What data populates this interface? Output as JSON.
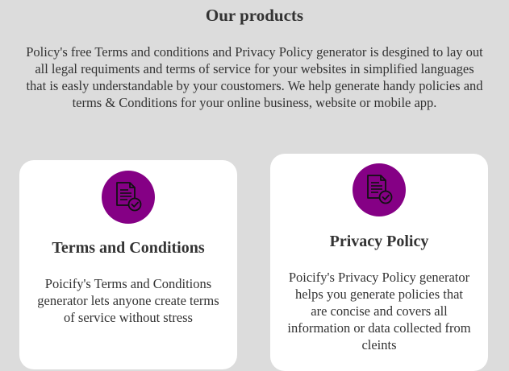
{
  "section": {
    "title": "Our products",
    "intro": "Policy's free Terms and conditions and Privacy Policy generator is desgined to lay out all legal requiments and terms of service for your websites in simplified languages that is easly understandable by your coustomers. We help generate handy policies and terms & Conditions for your online business, website or mobile app."
  },
  "cards": [
    {
      "title": "Terms and Conditions",
      "description": "Poicify's Terms and Conditions generator lets anyone create terms of service without stress",
      "icon": "document-check-icon"
    },
    {
      "title": "Privacy Policy",
      "description": "Poicify's Privacy Policy generator helps you generate policies that are concise and covers all information or data collected from cleints",
      "icon": "document-check-icon"
    }
  ],
  "colors": {
    "background": "#dcdcdc",
    "card": "#ffffff",
    "accent": "#850085"
  }
}
